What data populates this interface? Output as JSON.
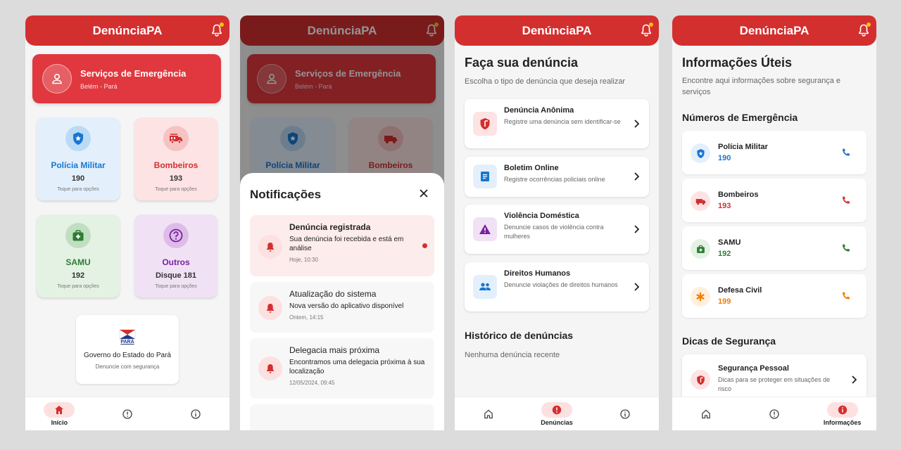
{
  "app_title": "DenúnciaPA",
  "colors": {
    "primary": "#d32f2f",
    "notification_dot": "#ffc107",
    "police": "#1976d2",
    "fire": "#d32f2f",
    "samu": "#2e7d32",
    "other": "#7b1fa2",
    "civil": "#f57c00"
  },
  "home": {
    "hero": {
      "title": "Serviços de Emergência",
      "subtitle": "Belém - Pará",
      "icon": "person-icon"
    },
    "services": [
      {
        "name": "Polícia Militar",
        "number": "190",
        "hint": "Toque para opções",
        "icon": "shield-icon"
      },
      {
        "name": "Bombeiros",
        "number": "193",
        "hint": "Toque para opções",
        "icon": "fire-truck-icon"
      },
      {
        "name": "SAMU",
        "number": "192",
        "hint": "Toque para opções",
        "icon": "medical-kit-icon"
      },
      {
        "name": "Outros",
        "number": "Disque 181",
        "hint": "Toque para opções",
        "icon": "help-icon"
      }
    ],
    "gov": {
      "logo_text": "PARÁ",
      "title": "Governo do Estado do Pará",
      "subtitle": "Denuncie com segurança"
    }
  },
  "nav": {
    "home": "Início",
    "reports": "Denúncias",
    "info": "Informações"
  },
  "notifications": {
    "title": "Notificações",
    "items": [
      {
        "title": "Denúncia registrada",
        "body": "Sua denúncia foi recebida e está em análise",
        "time": "Hoje, 10:30"
      },
      {
        "title": "Atualização do sistema",
        "body": "Nova versão do aplicativo disponível",
        "time": "Ontem, 14:15"
      },
      {
        "title": "Delegacia mais próxima",
        "body": "Encontramos uma delegacia próxima à sua localização",
        "time": "12/05/2024, 09:45"
      }
    ]
  },
  "reports": {
    "title": "Faça sua denúncia",
    "subtitle": "Escolha o tipo de denúncia que deseja realizar",
    "types": [
      {
        "title": "Denúncia Anônima",
        "desc": "Registre uma denúncia sem identificar-se",
        "icon": "shield-icon"
      },
      {
        "title": "Boletim Online",
        "desc": "Registre ocorrências policiais online",
        "icon": "document-icon"
      },
      {
        "title": "Violência Doméstica",
        "desc": "Denuncie casos de violência contra mulheres",
        "icon": "warning-icon"
      },
      {
        "title": "Direitos Humanos",
        "desc": "Denuncie violações de direitos humanos",
        "icon": "people-icon"
      }
    ],
    "history_title": "Histórico de denúncias",
    "history_empty": "Nenhuma denúncia recente"
  },
  "info": {
    "title": "Informações Úteis",
    "subtitle": "Encontre aqui informações sobre segurança e serviços",
    "emergency_title": "Números de Emergência",
    "numbers": [
      {
        "name": "Polícia Militar",
        "number": "190"
      },
      {
        "name": "Bombeiros",
        "number": "193"
      },
      {
        "name": "SAMU",
        "number": "192"
      },
      {
        "name": "Defesa Civil",
        "number": "199"
      }
    ],
    "tips_title": "Dicas de Segurança",
    "tips": [
      {
        "title": "Segurança Pessoal",
        "desc": "Dicas para se proteger em situações de risco"
      }
    ]
  }
}
